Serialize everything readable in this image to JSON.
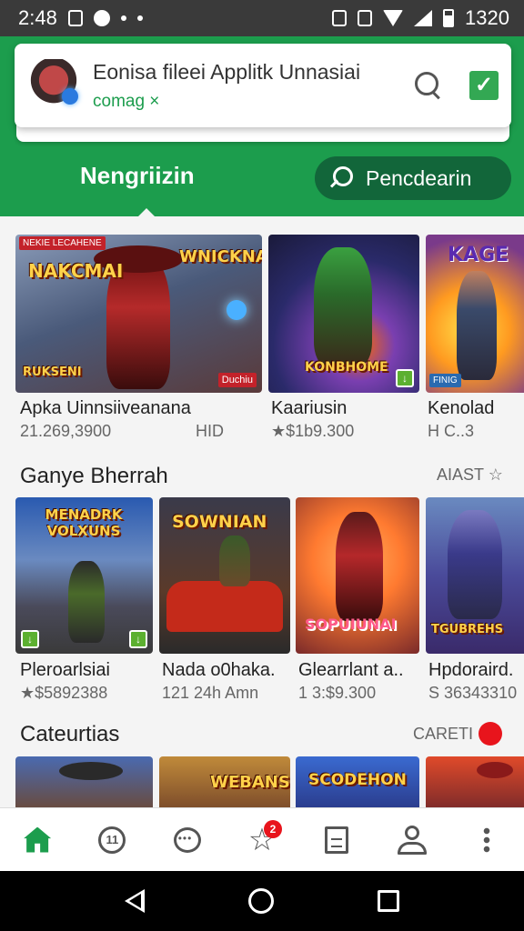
{
  "status_bar": {
    "time": "2:48",
    "clock": "1320"
  },
  "notification": {
    "title": "Eonisa fileei Applitk Unnasiai",
    "subtitle": "comag ×",
    "check_icon": "check-box-icon",
    "search_icon": "search-icon"
  },
  "header": {
    "active_tab": "Nengriizin",
    "search_button": "Pencdearin",
    "colors": {
      "brand_green": "#1c9d4d",
      "pill_green": "#12663a"
    }
  },
  "featured": [
    {
      "art_label": "NAKCMAI",
      "art_label_2": "WNICKNAV",
      "tag": "Duchiu",
      "ribbon": "NEKIE LECAHENE",
      "corner": "RUKSENI",
      "title": "Apka Uinnsiiveanana",
      "meta_left": "21.269,3900",
      "meta_right": "HID"
    },
    {
      "art_label": "KONBHOME",
      "title": "Kaariusin",
      "meta": "★$1b9.300"
    },
    {
      "art_label": "KAGE",
      "tag": "FINIG",
      "title": "Kenolad",
      "meta": "H C..3"
    }
  ],
  "section1": {
    "title": "Ganye Bherrah",
    "action": "AIAST ☆",
    "items": [
      {
        "art_label": "MENADRK VOLXUNS",
        "title": "Pleroarlsiai",
        "meta": "★$5892388"
      },
      {
        "art_label": "SOWNIAN",
        "title": "Nada o0haka.",
        "meta": "121 24h Amn"
      },
      {
        "art_label": "SOPUIUNAI",
        "title": "Glearrlant a..",
        "meta": "1 3:$9.300"
      },
      {
        "art_label": "TGUBREHS",
        "title": "Hpdoraird.",
        "meta": "S 36343310"
      }
    ]
  },
  "section2": {
    "title": "Cateurtias",
    "action": "CARETI",
    "items": [
      {
        "art_label": ""
      },
      {
        "art_label": "WEBANS"
      },
      {
        "art_label": "SCODEHON"
      },
      {
        "art_label": ""
      }
    ]
  },
  "bottom_nav": {
    "items": [
      {
        "name": "home-icon"
      },
      {
        "name": "updates-icon",
        "label": "11"
      },
      {
        "name": "chat-icon"
      },
      {
        "name": "favorites-icon",
        "badge": "2"
      },
      {
        "name": "library-icon"
      },
      {
        "name": "profile-icon"
      },
      {
        "name": "more-icon"
      }
    ]
  }
}
